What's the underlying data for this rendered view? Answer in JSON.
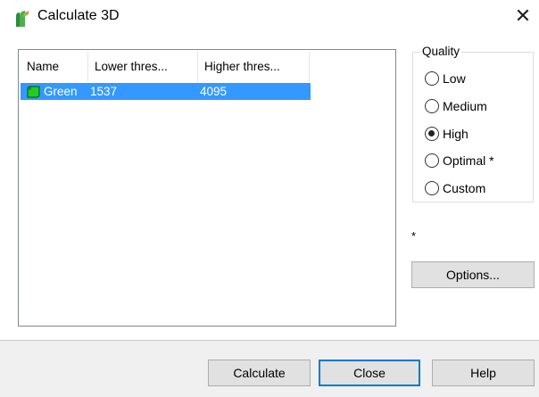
{
  "window": {
    "title": "Calculate 3D",
    "close_glyph": "✕"
  },
  "table": {
    "columns": [
      "Name",
      "Lower thres...",
      "Higher thres..."
    ],
    "rows": [
      {
        "name": "Green",
        "lower": "1537",
        "higher": "4095",
        "color": "#22cc22",
        "selected": true
      }
    ]
  },
  "quality": {
    "legend": "Quality",
    "options": [
      {
        "label": "Low",
        "checked": false
      },
      {
        "label": "Medium",
        "checked": false
      },
      {
        "label": "High",
        "checked": true
      },
      {
        "label": "Optimal *",
        "checked": false
      },
      {
        "label": "Custom",
        "checked": false
      }
    ]
  },
  "footnote_star": "*",
  "buttons": {
    "options": "Options...",
    "calculate": "Calculate",
    "close": "Close",
    "help": "Help"
  },
  "colors": {
    "selection": "#3399ff",
    "default_button_border": "#0078d7"
  },
  "icons": {
    "app": "greenhouse-app-icon",
    "close": "close-icon",
    "swatch": "color-swatch-icon"
  }
}
